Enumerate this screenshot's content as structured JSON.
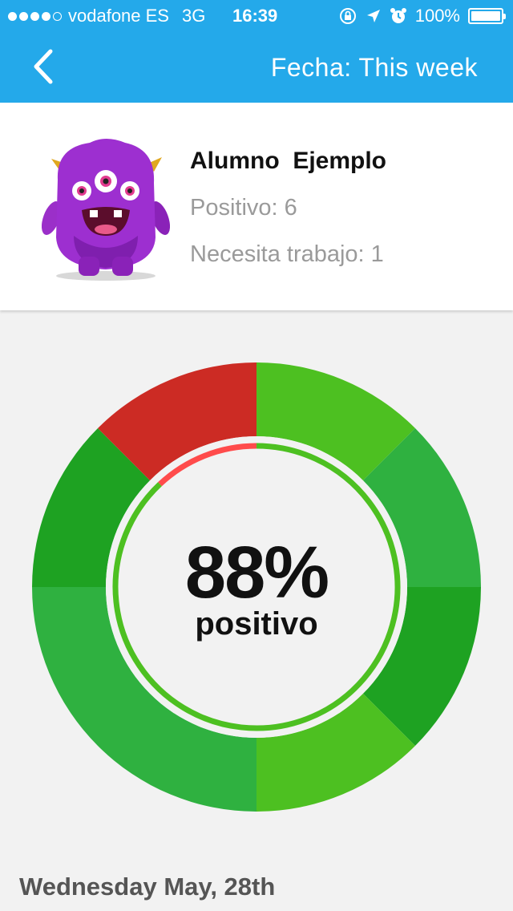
{
  "status_bar": {
    "carrier": "vodafone ES",
    "network": "3G",
    "time": "16:39",
    "battery": "100%",
    "signal_dots_filled": 4,
    "signal_dots_total": 5
  },
  "nav": {
    "back_icon": "chevron-left-icon",
    "title": "Fecha: This week"
  },
  "student": {
    "name": "Alumno  Ejemplo",
    "positive": "Positivo: 6",
    "needs_work": "Necesita trabajo: 1",
    "avatar_icon": "purple-monster-avatar"
  },
  "summary": {
    "percent": "88%",
    "label": "positivo"
  },
  "chart_data": {
    "type": "pie",
    "donut": true,
    "slices": [
      {
        "value": 1,
        "color": "#4dc021",
        "kind": "positive"
      },
      {
        "value": 1,
        "color": "#2fb140",
        "kind": "positive"
      },
      {
        "value": 1,
        "color": "#1ea222",
        "kind": "positive"
      },
      {
        "value": 1,
        "color": "#4dc021",
        "kind": "positive"
      },
      {
        "value": 2,
        "color": "#2fb140",
        "kind": "positive"
      },
      {
        "value": 1,
        "color": "#1ea222",
        "kind": "positive"
      },
      {
        "value": 1,
        "color": "#cc2b24",
        "kind": "needs_work"
      }
    ],
    "inner_ring": {
      "positive_fraction": 0.88,
      "positive_color": "#4dc021",
      "negative_color": "#ff4b4b"
    }
  },
  "day_heading": "Wednesday May, 28th",
  "colors": {
    "header": "#24a9ea",
    "background": "#f2f2f2"
  }
}
